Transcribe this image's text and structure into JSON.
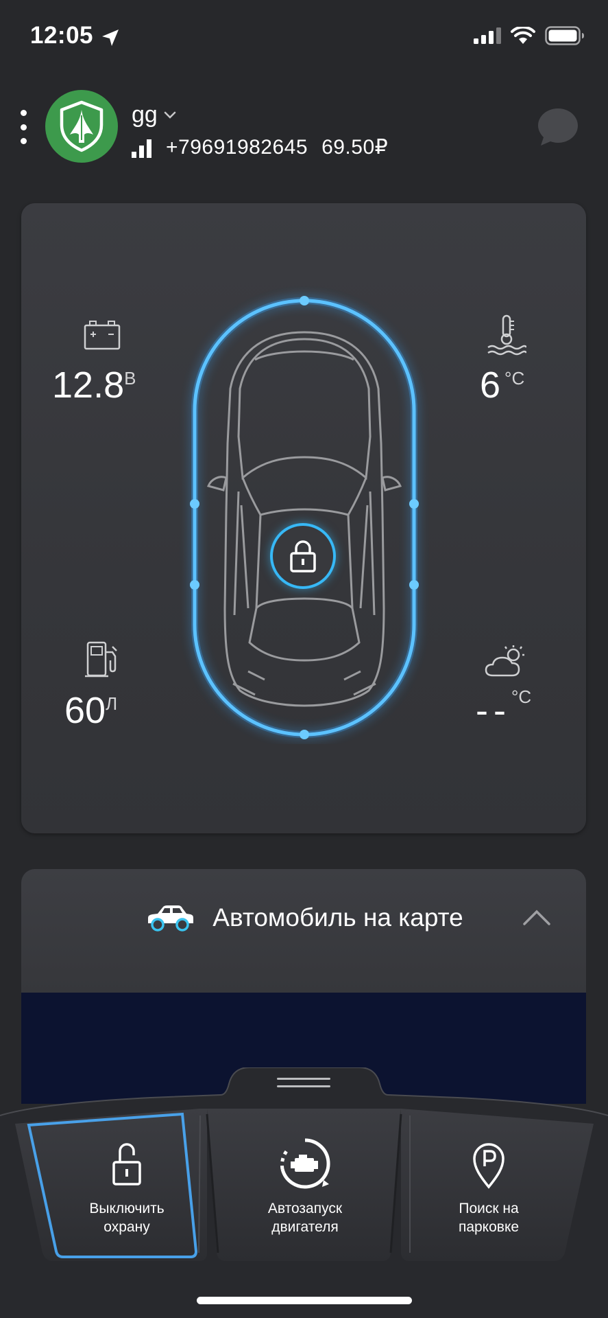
{
  "status_bar": {
    "time": "12:05",
    "icons": [
      "location-arrow-icon",
      "cellular-signal-icon",
      "wifi-icon",
      "battery-icon"
    ]
  },
  "header": {
    "user_name": "gg",
    "phone": "+79691982645",
    "balance": "69.50₽",
    "icons": [
      "menu-dots-icon",
      "shield-logo-icon",
      "chevron-down-icon",
      "signal-bars-icon",
      "chat-bubble-icon"
    ]
  },
  "car_status": {
    "battery": {
      "value": "12.8",
      "unit": "В",
      "icon": "battery-icon"
    },
    "engine_temp": {
      "value": "6",
      "unit": "°C",
      "icon": "coolant-temperature-icon"
    },
    "fuel": {
      "value": "60",
      "unit": "Л",
      "icon": "fuel-pump-icon"
    },
    "outside_temp": {
      "value": "--",
      "unit": "°C",
      "icon": "weather-cloud-sun-icon"
    },
    "lock_state": "locked",
    "icons": [
      "car-top-view-icon",
      "lock-icon"
    ]
  },
  "map_section": {
    "title": "Автомобиль на карте",
    "icons": [
      "car-side-icon",
      "chevron-up-icon"
    ]
  },
  "controls": [
    {
      "label_line1": "Выключить",
      "label_line2": "охрану",
      "icon": "unlock-icon",
      "active": true
    },
    {
      "label_line1": "Автозапуск",
      "label_line2": "двигателя",
      "icon": "engine-autostart-icon",
      "active": false
    },
    {
      "label_line1": "Поиск на",
      "label_line2": "парковке",
      "icon": "parking-pin-icon",
      "active": false
    }
  ],
  "colors": {
    "background": "#27282b",
    "card": "#38393d",
    "accent_blue": "#4fb6ff",
    "avatar_green": "#3d9a4c",
    "map_navy": "#0c1330"
  }
}
